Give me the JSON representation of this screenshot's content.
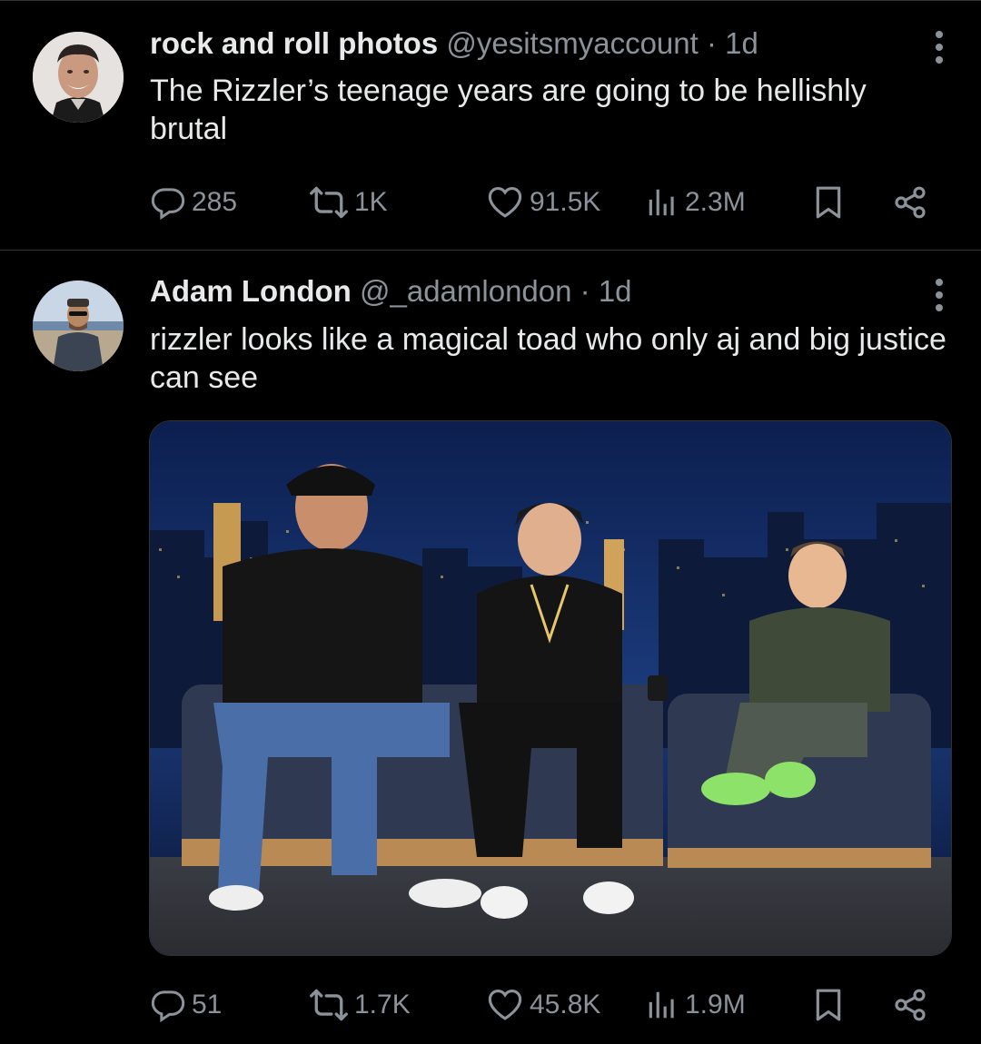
{
  "tweets": [
    {
      "display_name": "rock and roll photos",
      "handle": "@yesitsmyaccount",
      "separator": "·",
      "time": "1d",
      "text": "The Rizzler’s teenage years are going to be hellishly brutal",
      "stats": {
        "replies": "285",
        "reposts": "1K",
        "likes": "91.5K",
        "views": "2.3M"
      },
      "avatar_icon": "avatar-photo"
    },
    {
      "display_name": "Adam London",
      "handle": "@_adamlondon",
      "separator": "·",
      "time": "1d",
      "text": "rizzler looks like a magical toad who only aj and big justice can see",
      "stats": {
        "replies": "51",
        "reposts": "1.7K",
        "likes": "45.8K",
        "views": "1.9M"
      },
      "avatar_icon": "avatar-photo",
      "media_description_icon": "talk-show-photo"
    }
  ],
  "colors": {
    "background": "#000000",
    "text": "#e7e9ea",
    "muted": "#8b9299",
    "divider": "#2f3336"
  }
}
